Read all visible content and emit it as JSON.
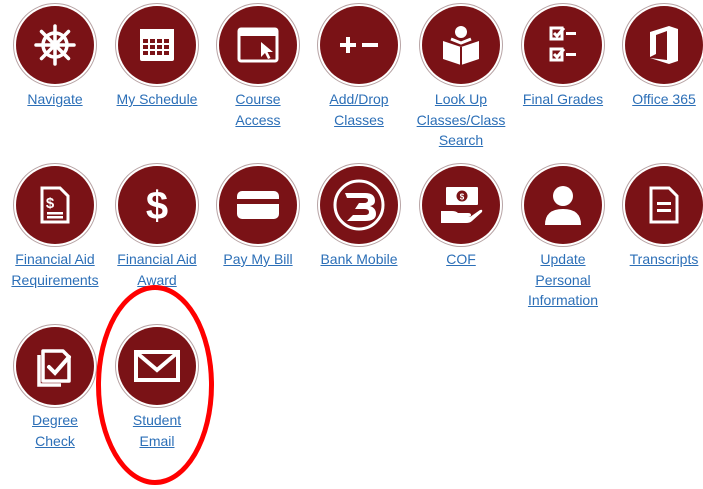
{
  "theme": {
    "icon_bg": "#7a1216",
    "link_color": "#2c6fb7",
    "highlight": "#ff0000"
  },
  "tiles": [
    {
      "icon": "ship-wheel-icon",
      "label": "Navigate"
    },
    {
      "icon": "calendar-grid-icon",
      "label": "My Schedule"
    },
    {
      "icon": "browser-window-cursor-icon",
      "label": "Course\nAccess"
    },
    {
      "icon": "plus-minus-icon",
      "label": "Add/Drop\nClasses"
    },
    {
      "icon": "reading-book-icon",
      "label": "Look Up\nClasses/Class\nSearch"
    },
    {
      "icon": "checklist-icon",
      "label": "Final Grades"
    },
    {
      "icon": "office-logo-icon",
      "label": "Office 365"
    },
    {
      "icon": "dollar-document-icon",
      "label": "Financial Aid\nRequirements"
    },
    {
      "icon": "dollar-sign-icon",
      "label": "Financial Aid\nAward"
    },
    {
      "icon": "credit-card-icon",
      "label": "Pay My Bill"
    },
    {
      "icon": "bankmobile-b-icon",
      "label": "Bank Mobile"
    },
    {
      "icon": "money-in-hand-icon",
      "label": "COF"
    },
    {
      "icon": "person-icon",
      "label": "Update\nPersonal\nInformation"
    },
    {
      "icon": "document-lines-icon",
      "label": "Transcripts"
    },
    {
      "icon": "degree-check-icon",
      "label": "Degree\nCheck"
    },
    {
      "icon": "envelope-icon",
      "label": "Student\nEmail"
    }
  ],
  "highlighted_tile": "Student Email"
}
